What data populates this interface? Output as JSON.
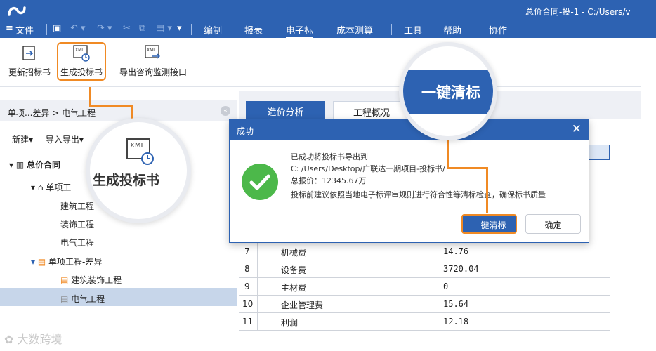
{
  "window": {
    "title": "总价合同-投-1 - C:/Users/v"
  },
  "menu": {
    "file": "文件",
    "edit": "编制",
    "report": "报表",
    "tender": "电子标",
    "cost": "成本测算",
    "tools": "工具",
    "help": "帮助",
    "collab": "协作"
  },
  "ribbon": {
    "update": "更新招标书",
    "generate": "生成投标书",
    "export": "导出咨询监测接口",
    "xml": "XML"
  },
  "left": {
    "breadcrumb": "单项...差异 > 电气工程",
    "new": "新建",
    "import_export": "导入导出",
    "tree": {
      "root": "总价合同",
      "unit1": "单项工",
      "item1": "建筑工程",
      "item2": "装饰工程",
      "item3": "电气工程",
      "unit2": "单项工程-差异",
      "item4": "建筑装饰工程",
      "item5": "电气工程"
    }
  },
  "tabs": {
    "cost_analysis": "造价分析",
    "overview": "工程概况"
  },
  "table": {
    "rows": [
      {
        "no": "7",
        "name": "机械费",
        "value": "14.76"
      },
      {
        "no": "8",
        "name": "设备费",
        "value": "3720.04"
      },
      {
        "no": "9",
        "name": "主材费",
        "value": "0"
      },
      {
        "no": "10",
        "name": "企业管理费",
        "value": "15.64"
      },
      {
        "no": "11",
        "name": "利润",
        "value": "12.18"
      }
    ]
  },
  "dialog": {
    "title": "成功",
    "line1": "已成功将投标书导出到",
    "line2": "C: /Users/Desktop/广联达一期项目-投标书/",
    "line3": "总报价：12345.67万",
    "line4": "投标前建议依照当地电子标评审规则进行符合性等清标检查，确保标书质量",
    "primary": "一键清标",
    "secondary": "确定"
  },
  "callouts": {
    "zoom_button": "一键清标",
    "zoom_ribbon": "生成投标书"
  },
  "watermark": "大数跨境",
  "colors": {
    "brand": "#2d62b2",
    "highlight": "#f08a24",
    "success": "#4cb84a"
  }
}
